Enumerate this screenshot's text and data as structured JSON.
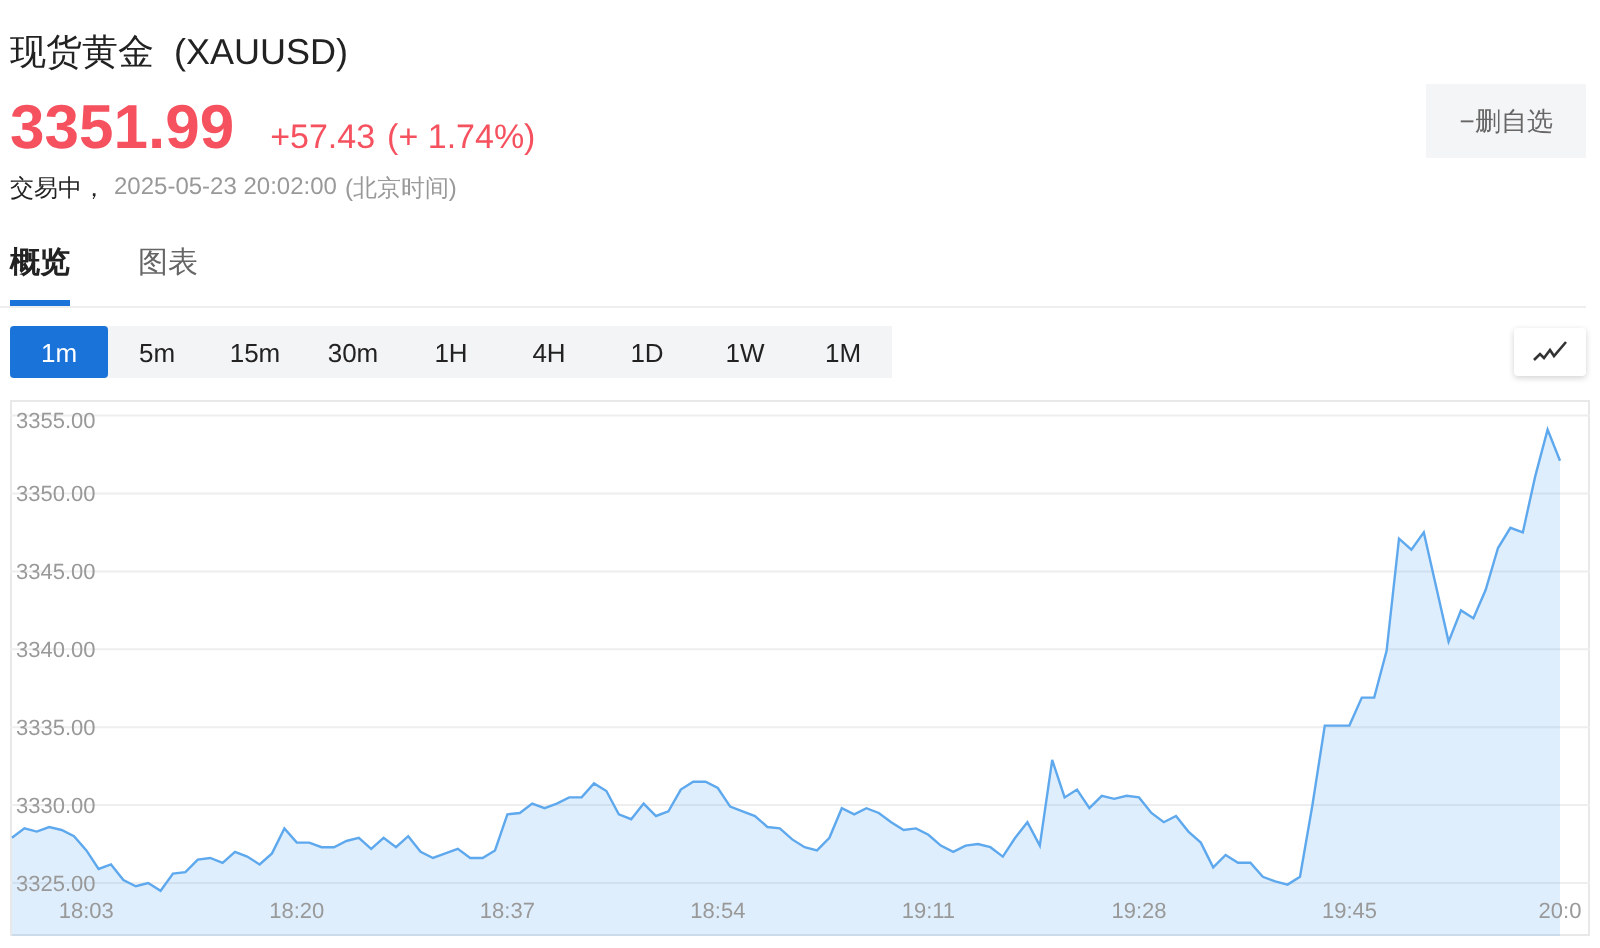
{
  "header": {
    "title": "现货黄金  (XAUUSD)",
    "price": "3351.99",
    "change": "+57.43",
    "change_pct": "(+ 1.74%)",
    "status": "交易中，",
    "timestamp": "2025-05-23 20:02:00",
    "timezone": "(北京时间)",
    "watch_button": "−删自选"
  },
  "tabs": [
    {
      "label": "概览",
      "selected": true
    },
    {
      "label": "图表",
      "selected": false
    }
  ],
  "intervals": [
    {
      "label": "1m",
      "selected": true
    },
    {
      "label": "5m",
      "selected": false
    },
    {
      "label": "15m",
      "selected": false
    },
    {
      "label": "30m",
      "selected": false
    },
    {
      "label": "1H",
      "selected": false
    },
    {
      "label": "4H",
      "selected": false
    },
    {
      "label": "1D",
      "selected": false
    },
    {
      "label": "1W",
      "selected": false
    },
    {
      "label": "1M",
      "selected": false
    }
  ],
  "chart": {
    "chart_data": {
      "type": "area",
      "ylim": [
        3321.6,
        3356
      ],
      "grid": true,
      "categories": [
        null,
        null,
        null,
        null,
        null,
        null,
        "18:03",
        null,
        null,
        null,
        null,
        null,
        null,
        null,
        null,
        null,
        null,
        null,
        null,
        null,
        null,
        null,
        null,
        "18:20",
        null,
        null,
        null,
        null,
        null,
        null,
        null,
        null,
        null,
        null,
        null,
        null,
        null,
        null,
        null,
        null,
        "18:37",
        null,
        null,
        null,
        null,
        null,
        null,
        null,
        null,
        null,
        null,
        null,
        null,
        null,
        null,
        null,
        null,
        "18:54",
        null,
        null,
        null,
        null,
        null,
        null,
        null,
        null,
        null,
        null,
        null,
        null,
        null,
        null,
        null,
        null,
        "19:11",
        null,
        null,
        null,
        null,
        null,
        null,
        null,
        null,
        null,
        null,
        null,
        null,
        null,
        null,
        null,
        null,
        "19:28",
        null,
        null,
        null,
        null,
        null,
        null,
        null,
        null,
        null,
        null,
        null,
        null,
        null,
        null,
        null,
        null,
        "19:45",
        null,
        null,
        null,
        null,
        null,
        null,
        null,
        null,
        null,
        null,
        null,
        null,
        null,
        null,
        null,
        null,
        "20:0"
      ],
      "series": [
        {
          "color": "#5ea8ee",
          "values": [
            3327.9,
            3328.5,
            3328.3,
            3328.6,
            3328.4,
            3328,
            3327.1,
            3325.9,
            3326.2,
            3325.2,
            3324.8,
            3325,
            3324.5,
            3325.6,
            3325.7,
            3326.5,
            3326.6,
            3326.3,
            3327,
            3326.7,
            3326.2,
            3326.9,
            3328.5,
            3327.6,
            3327.6,
            3327.3,
            3327.3,
            3327.7,
            3327.9,
            3327.2,
            3327.9,
            3327.3,
            3328,
            3327,
            3326.6,
            3326.9,
            3327.2,
            3326.6,
            3326.6,
            3327.1,
            3329.4,
            3329.5,
            3330.1,
            3329.8,
            3330.1,
            3330.5,
            3330.5,
            3331.4,
            3330.9,
            3329.4,
            3329.1,
            3330.1,
            3329.3,
            3329.6,
            3331,
            3331.5,
            3331.5,
            3331.1,
            3329.9,
            3329.6,
            3329.3,
            3328.6,
            3328.5,
            3327.8,
            3327.3,
            3327.1,
            3327.9,
            3329.8,
            3329.4,
            3329.8,
            3329.5,
            3328.9,
            3328.4,
            3328.5,
            3328.1,
            3327.4,
            3327,
            3327.4,
            3327.5,
            3327.3,
            3326.7,
            3327.9,
            3328.9,
            3327.4,
            3332.9,
            3330.5,
            3331,
            3329.8,
            3330.6,
            3330.4,
            3330.6,
            3330.5,
            3329.5,
            3328.9,
            3329.3,
            3328.3,
            3327.6,
            3326,
            3326.8,
            3326.3,
            3326.3,
            3325.4,
            3325.1,
            3324.9,
            3325.4,
            3330,
            3335.1,
            3335.1,
            3335.1,
            3336.9,
            3336.9,
            3339.9,
            3347.1,
            3346.4,
            3347.5,
            3344,
            3340.5,
            3342.5,
            3342,
            3343.8,
            3346.5,
            3347.8,
            3347.5,
            3351.1,
            3354.1,
            3352.1
          ]
        }
      ],
      "yticks": [
        {
          "value": 3355,
          "label": "3355.00"
        },
        {
          "value": 3350,
          "label": "3350.00"
        },
        {
          "value": 3345,
          "label": "3345.00"
        },
        {
          "value": 3340,
          "label": "3340.00"
        },
        {
          "value": 3335,
          "label": "3335.00"
        },
        {
          "value": 3330,
          "label": "3330.00"
        },
        {
          "value": 3325,
          "label": "3325.00"
        }
      ]
    }
  }
}
